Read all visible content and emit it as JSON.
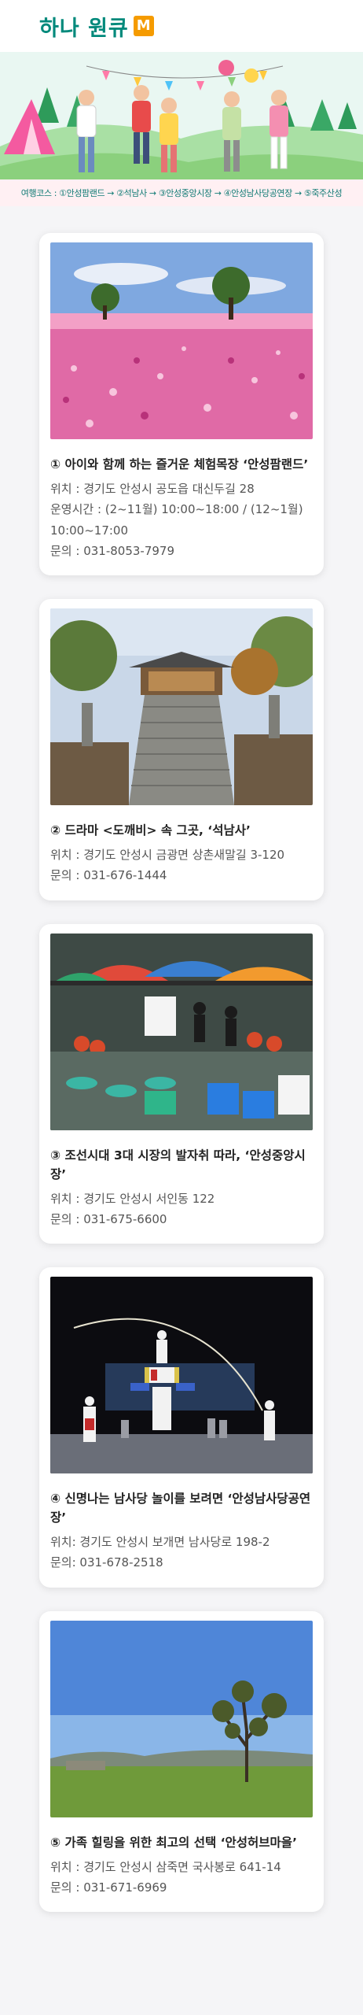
{
  "header": {
    "logo_text": "하나 원큐",
    "logo_badge": "M"
  },
  "banner": {
    "route_text": "여행코스 : ①안성팜랜드 → ②석남사 → ③안성중앙시장 → ④안성남사당공연장 → ⑤죽주산성"
  },
  "cards": [
    {
      "title": "① 아이와 함께 하는 즐거운 체험목장 ‘안성팜랜드’",
      "location": "위치 : 경기도 안성시 공도읍 대신두길 28",
      "hours": "운영시간 : (2~11월) 10:00~18:00 / (12~1월) 10:00~17:00",
      "contact": "문의 : 031-8053-7979"
    },
    {
      "title": "② 드라마 <도깨비> 속 그곳, ‘석남사’",
      "location": "위치 : 경기도 안성시 금광면 상촌새말길 3-120",
      "contact": "문의 : 031-676-1444"
    },
    {
      "title": "③ 조선시대 3대 시장의 발자취 따라, ‘안성중앙시장’",
      "location": "위치 : 경기도 안성시 서인동 122",
      "contact": "문의 : 031-675-6600"
    },
    {
      "title": "④ 신명나는 남사당 놀이를 보려면 ‘안성남사당공연장’",
      "location": "위치: 경기도 안성시 보개면 남사당로 198-2",
      "contact": "문의: 031-678-2518"
    },
    {
      "title": "⑤ 가족 힐링을 위한 최고의 선택 ‘안성허브마을’",
      "location": "위치 : 경기도 안성시 삼죽면 국사봉로 641-14",
      "contact": "문의 : 031-671-6969"
    }
  ]
}
